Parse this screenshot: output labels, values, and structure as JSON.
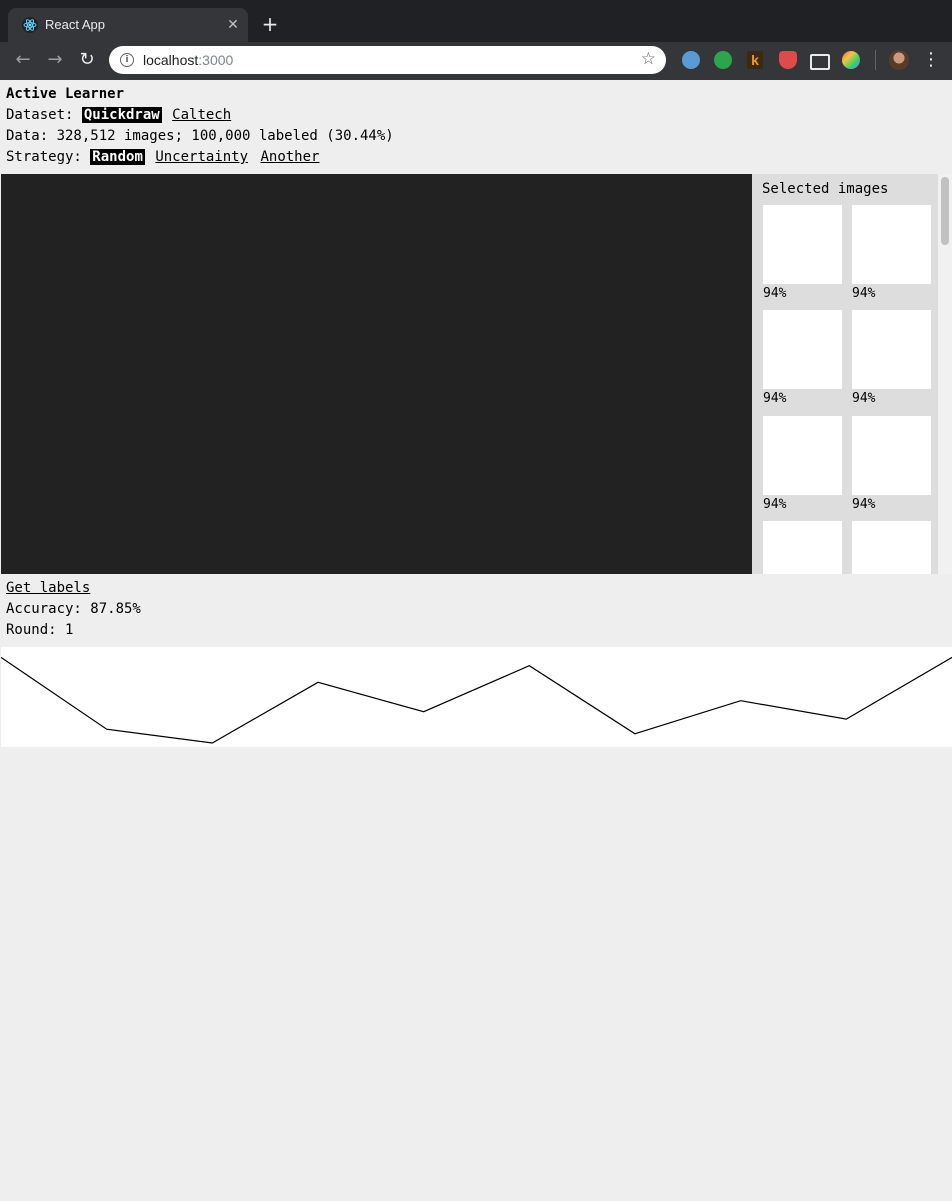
{
  "browser": {
    "tab_title": "React App",
    "url_host": "localhost",
    "url_port": ":3000"
  },
  "app": {
    "title": "Active Learner",
    "dataset": {
      "label": "Dataset: ",
      "options": [
        "Quickdraw",
        "Caltech"
      ],
      "selected": "Quickdraw"
    },
    "data_summary": "Data: 328,512 images; 100,000 labeled (30.44%)",
    "strategy": {
      "label": "Strategy: ",
      "options": [
        "Random",
        "Uncertainty",
        "Another"
      ],
      "selected": "Random"
    },
    "selected_images": {
      "title": "Selected images",
      "items": [
        {
          "label": "94%"
        },
        {
          "label": "94%"
        },
        {
          "label": "94%"
        },
        {
          "label": "94%"
        },
        {
          "label": "94%"
        },
        {
          "label": "94%"
        },
        {
          "label": ""
        },
        {
          "label": ""
        }
      ]
    },
    "get_labels": "Get labels",
    "accuracy": "Accuracy: 87.85%",
    "round": "Round: 1"
  },
  "chart_data": {
    "type": "line",
    "title": "",
    "xlabel": "",
    "ylabel": "",
    "x": [
      0,
      1,
      2,
      3,
      4,
      5,
      6,
      7,
      8,
      9
    ],
    "values": [
      0.93,
      0.15,
      0.0,
      0.66,
      0.34,
      0.84,
      0.1,
      0.46,
      0.26,
      0.93
    ],
    "ylim": [
      0,
      1
    ],
    "grid": false,
    "stroke": "#000000"
  }
}
